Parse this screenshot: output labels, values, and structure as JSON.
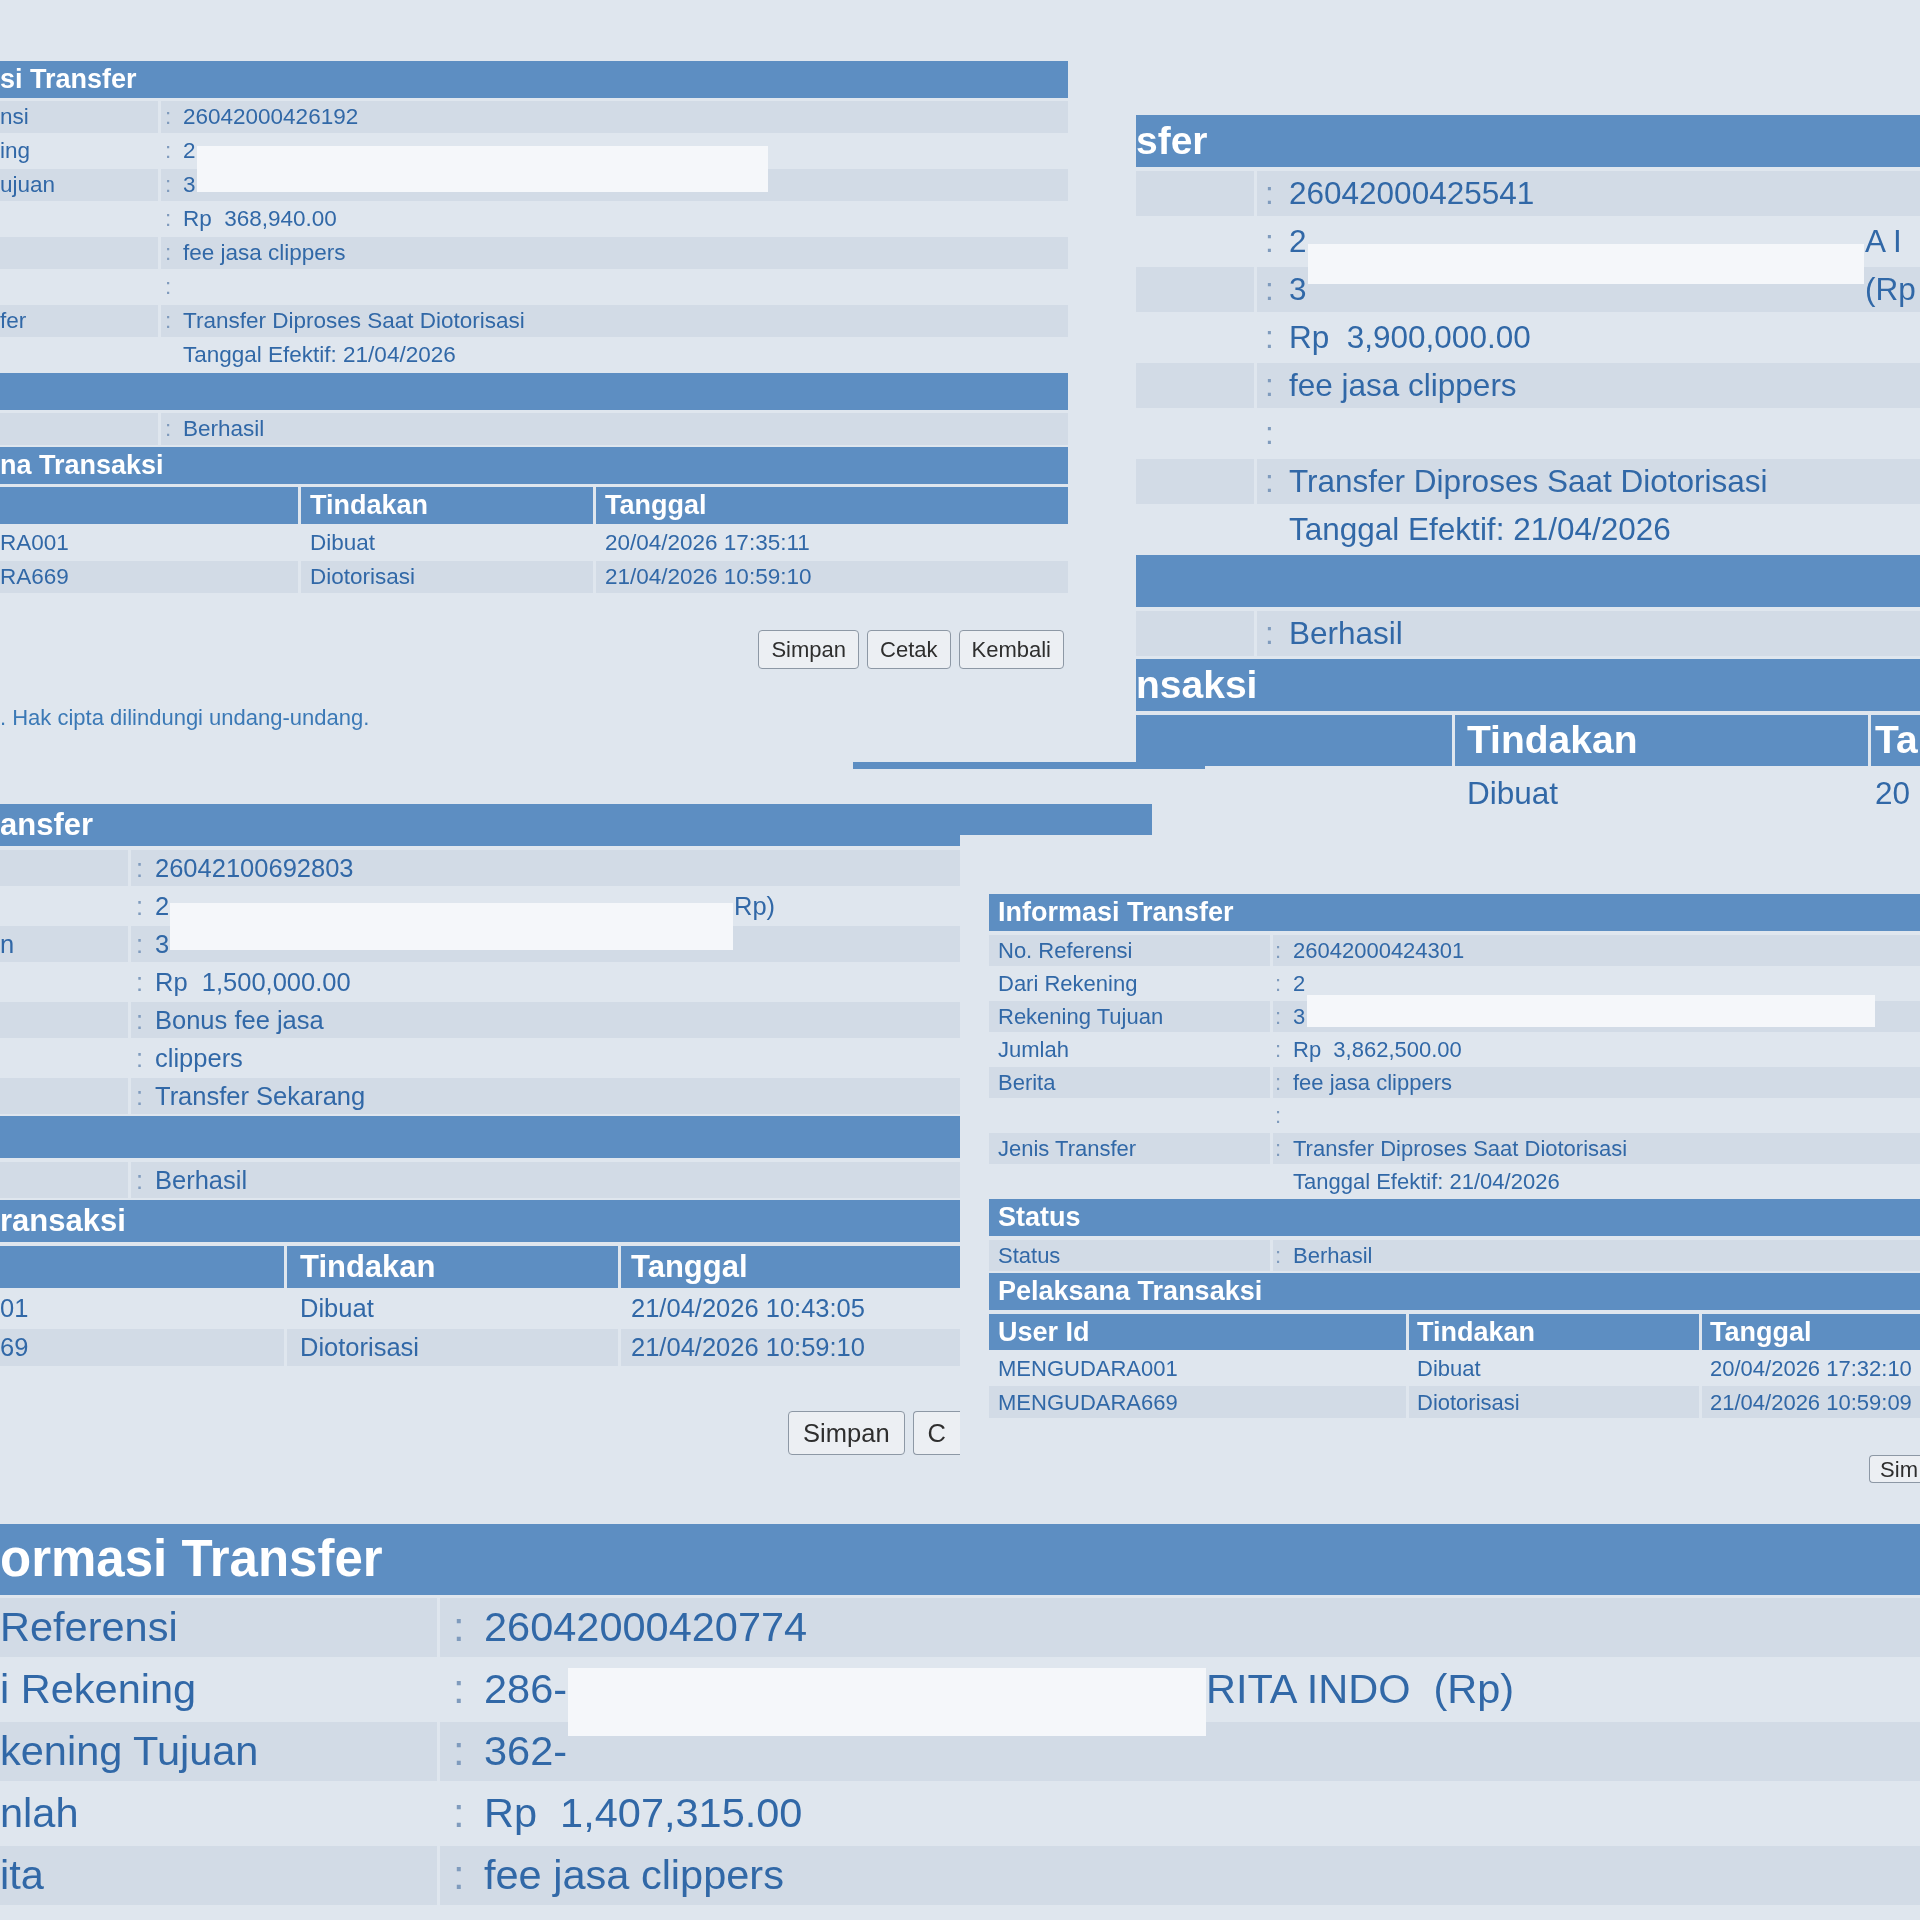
{
  "panels": [
    {
      "sections": [
        {
          "kind": "info",
          "title": "si Transfer",
          "rows": [
            {
              "label": "nsi",
              "separator": ":",
              "value": "26042000426192"
            },
            {
              "label": "ing",
              "separator": ":",
              "value": "2",
              "redacted": true
            },
            {
              "label": "ujuan",
              "separator": ":",
              "value": "3"
            },
            {
              "separator": ":",
              "value": "Rp  368,940.00"
            },
            {
              "separator": ":",
              "value": "fee jasa clippers"
            },
            {
              "separator": ":"
            },
            {
              "label": "fer",
              "separator": ":",
              "value": "Transfer Diproses Saat Diotorisasi"
            },
            {
              "value": "Tanggal Efektif: 21/04/2026"
            }
          ]
        },
        {
          "kind": "info",
          "rows": [
            {
              "separator": ":",
              "value": "Berhasil"
            }
          ]
        },
        {
          "kind": "table",
          "title": "na Transaksi",
          "columns": [
            {
              "kind": "blank"
            },
            {
              "kind": "label",
              "label": "Tindakan"
            },
            {
              "kind": "label",
              "label": "Tanggal"
            }
          ],
          "rows": [
            [
              "RA001",
              "Dibuat",
              "20/04/2026 17:35:11"
            ],
            [
              "RA669",
              "Diotorisasi",
              "21/04/2026 10:59:10"
            ]
          ]
        }
      ],
      "buttons": [
        {
          "label": "Simpan"
        },
        {
          "label": "Cetak"
        },
        {
          "label": "Kembali"
        }
      ],
      "footer": ". Hak cipta dilindungi undang-undang."
    },
    {
      "sections": [
        {
          "kind": "info",
          "title": "sfer",
          "rows": [
            {
              "separator": ":",
              "value": "26042000425541"
            },
            {
              "separator": ":",
              "value": "2",
              "redacted": true,
              "tail": "A I"
            },
            {
              "separator": ":",
              "value": "3",
              "tail": "(Rp"
            },
            {
              "separator": ":",
              "value": "Rp  3,900,000.00"
            },
            {
              "separator": ":",
              "value": "fee jasa clippers"
            },
            {
              "separator": ":"
            },
            {
              "separator": ":",
              "value": "Transfer Diproses Saat Diotorisasi"
            },
            {
              "value": "Tanggal Efektif: 21/04/2026"
            }
          ]
        },
        {
          "kind": "info",
          "rows": [
            {
              "separator": ":",
              "value": "Berhasil"
            }
          ]
        },
        {
          "kind": "table",
          "title": "nsaksi",
          "columns": [
            {
              "kind": "blank"
            },
            {
              "kind": "label",
              "label": "Tindakan"
            },
            {
              "kind": "label",
              "label": "Ta"
            }
          ],
          "rows": [
            [
              null,
              "Dibuat",
              "20"
            ]
          ]
        }
      ]
    },
    {
      "sections": [
        {
          "kind": "info",
          "title": "ansfer",
          "rows": [
            {
              "separator": ":",
              "value": "26042100692803"
            },
            {
              "separator": ":",
              "value": "2",
              "redacted": true,
              "tail": "Rp)"
            },
            {
              "label": "n",
              "separator": ":",
              "value": "3"
            },
            {
              "separator": ":",
              "value": "Rp  1,500,000.00"
            },
            {
              "separator": ":",
              "value": "Bonus fee jasa"
            },
            {
              "separator": ":",
              "value": "clippers"
            },
            {
              "separator": ":",
              "value": "Transfer Sekarang"
            }
          ]
        },
        {
          "kind": "info",
          "rows": [
            {
              "separator": ":",
              "value": "Berhasil"
            }
          ]
        },
        {
          "kind": "table",
          "title": "ransaksi",
          "columns": [
            {
              "kind": "blank"
            },
            {
              "kind": "label",
              "label": "Tindakan"
            },
            {
              "kind": "label",
              "label": "Tanggal"
            }
          ],
          "rows": [
            [
              "01",
              "Dibuat",
              "21/04/2026 10:43:05"
            ],
            [
              "69",
              "Diotorisasi",
              "21/04/2026 10:59:10"
            ]
          ]
        }
      ],
      "buttons": [
        {
          "label": "Simpan"
        },
        {
          "label": "C",
          "clipped": true
        }
      ]
    },
    {
      "sections": [
        {
          "kind": "info",
          "title": "Informasi Transfer",
          "rows": [
            {
              "label": "No. Referensi",
              "separator": ":",
              "value": "26042000424301"
            },
            {
              "label": "Dari Rekening",
              "separator": ":",
              "value": "2"
            },
            {
              "label": "Rekening Tujuan",
              "separator": ":",
              "value": "3",
              "redacted": true
            },
            {
              "label": "Jumlah",
              "separator": ":",
              "value": "Rp  3,862,500.00"
            },
            {
              "label": "Berita",
              "separator": ":",
              "value": "fee jasa clippers"
            },
            {
              "separator": ":"
            },
            {
              "label": "Jenis Transfer",
              "separator": ":",
              "value": "Transfer Diproses Saat Diotorisasi"
            },
            {
              "value": "Tanggal Efektif: 21/04/2026"
            }
          ]
        },
        {
          "kind": "info",
          "title": "Status",
          "rows": [
            {
              "label": "Status",
              "separator": ":",
              "value": "Berhasil"
            }
          ]
        },
        {
          "kind": "table",
          "title": "Pelaksana Transaksi",
          "columns": [
            {
              "kind": "label",
              "label": "User Id"
            },
            {
              "kind": "label",
              "label": "Tindakan"
            },
            {
              "kind": "label",
              "label": "Tanggal"
            }
          ],
          "rows": [
            [
              "MENGUDARA001",
              "Dibuat",
              "20/04/2026 17:32:10"
            ],
            [
              "MENGUDARA669",
              "Diotorisasi",
              "21/04/2026 10:59:09"
            ]
          ]
        }
      ],
      "buttons": [
        {
          "label": "Sim",
          "clipped": true
        }
      ]
    },
    {
      "sections": [
        {
          "kind": "info",
          "title": "ormasi Transfer",
          "rows": [
            {
              "label": "Referensi",
              "separator": ":",
              "value": "26042000420774"
            },
            {
              "label": "i Rekening",
              "separator": ":",
              "value": "286-",
              "redacted": true,
              "tail": "RITA INDO  (Rp)"
            },
            {
              "label": "kening Tujuan",
              "separator": ":",
              "value": "362-"
            },
            {
              "label": "nlah",
              "separator": ":",
              "value": "Rp  1,407,315.00"
            },
            {
              "label": "ita",
              "separator": ":",
              "value": "fee jasa clippers"
            }
          ]
        }
      ]
    }
  ]
}
